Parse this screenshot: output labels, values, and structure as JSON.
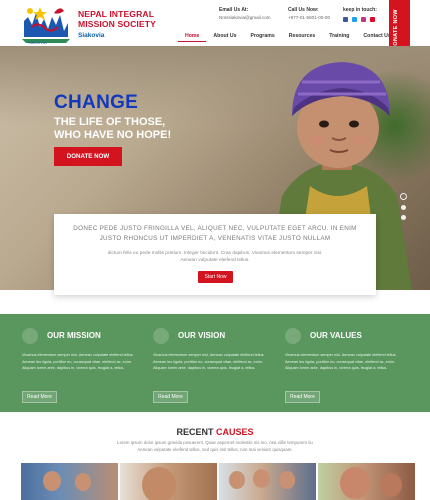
{
  "header": {
    "org_name_line1": "NEPAL INTEGRAL",
    "org_name_line2": "MISSION SOCIETY",
    "org_sub": "Siakovia",
    "email_label": "Email Us At:",
    "email_value": "Nmssiakovia@gmail.com",
    "call_label": "Call Us Now:",
    "call_value": "+977-01-5601-00-00",
    "social_label": "keep in touch:",
    "social_icons": [
      "facebook-icon",
      "twitter-icon",
      "instagram-icon",
      "pinterest-icon"
    ],
    "social_colors": [
      "#3b5998",
      "#1da1f2",
      "#c13584",
      "#e60023"
    ],
    "donate_label": "DONATE NOW"
  },
  "nav": {
    "items": [
      "Home",
      "About Us",
      "Programs",
      "Resources",
      "Training",
      "Contact Us"
    ],
    "active": "Home"
  },
  "hero": {
    "title": "CHANGE",
    "subtitle_line1": "THE LIFE OF THOSE,",
    "subtitle_line2": "WHO HAVE NO HOPE!",
    "button": "DONATE NOW"
  },
  "card": {
    "quote_line1": "DONEC PEDE JUSTO FRINGILLA VEL, ALIQUET NEC, VULPUTATE EGET ARCU. IN ENIM",
    "quote_line2": "JUSTO RHONCUS UT IMPERDIET A, VENENATIS VITAE JUSTO NULLAM",
    "text_line1": "dictum felis eu pede mollis pretium. Integer tincidunt. Cras dapibus. Vivamus elementum semper nisi.",
    "text_line2": "Aenean vulputate eleifend tellus.",
    "button": "Start Now"
  },
  "mission": [
    {
      "title": "OUR MISSION",
      "icon": "hand-heart-icon",
      "text": "Vivamus elementum semper nisi. Aenean vulputate eleifend tellus. Aenean leo ligula, porttitor eu, consequat vitae, eleifend ac, enim. Aliquam lorem ante, dapibus in, viverra quis, feugiat a, tellus.",
      "button": "Read More"
    },
    {
      "title": "OUR VISION",
      "icon": "eye-icon",
      "text": "Vivamus elementum semper nisi. Aenean vulputate eleifend tellus. Aenean leo ligula, porttitor eu, consequat vitae, eleifend ac, enim. Aliquam lorem ante, dapibus in, viverra quis, feugiat a, tellus.",
      "button": "Read More"
    },
    {
      "title": "OUR VALUES",
      "icon": "diamond-icon",
      "text": "Vivamus elementum semper nisi. Aenean vulputate eleifend tellus. Aenean leo ligula, porttitor eu, consequat vitae, eleifend ac, enim. Aliquam lorem ante, dapibus in, viverra quis, feugiat a, tellus.",
      "button": "Read More"
    }
  ],
  "causes": {
    "title_part1": "RECENT ",
    "title_part2": "CAUSES",
    "text_line1": "Lorem ipsum dolor ipsum gravida posuerent. Quae aspernet molestiis nis mo, nea villis tempurem tiu",
    "text_line2": "Aenean vulputate eleifend tellus, sed quis nisl tellus, non mai veniam quisquam."
  },
  "colors": {
    "brand_red": "#d3141f",
    "brand_blue": "#1338be",
    "band_green": "#5a975e"
  }
}
